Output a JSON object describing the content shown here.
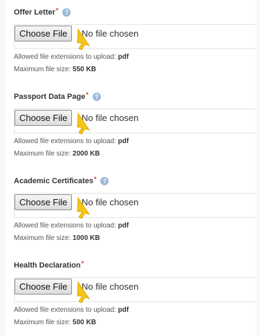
{
  "fields": [
    {
      "label": "Offer Letter",
      "required": "*",
      "button": "Choose File",
      "status": "No file chosen",
      "extensions_text": "Allowed file extensions to upload: ",
      "extensions": "pdf",
      "size_text": "Maximum file size: ",
      "size": "550 KB"
    },
    {
      "label": "Passport Data Page",
      "required": "*",
      "button": "Choose File",
      "status": "No file chosen",
      "extensions_text": "Allowed file extensions to upload: ",
      "extensions": "pdf",
      "size_text": "Maximum file size: ",
      "size": "2000 KB"
    },
    {
      "label": "Academic Certificates",
      "required": "*",
      "button": "Choose File",
      "status": "No file chosen",
      "extensions_text": "Allowed file extensions to upload: ",
      "extensions": "pdf",
      "size_text": "Maximum file size: ",
      "size": "1000 KB"
    },
    {
      "label": "Health Declaration",
      "required": "*",
      "button": "Choose File",
      "status": "No file chosen",
      "extensions_text": "Allowed file extensions to upload: ",
      "extensions": "pdf",
      "size_text": "Maximum file size: ",
      "size": "500 KB"
    }
  ],
  "help_icon": "info-circle-icon",
  "cursor_icon": "hand-pointer-icon",
  "colors": {
    "required": "#c0392b",
    "help": "#9cb8d8",
    "cursor": "#f5c518"
  }
}
